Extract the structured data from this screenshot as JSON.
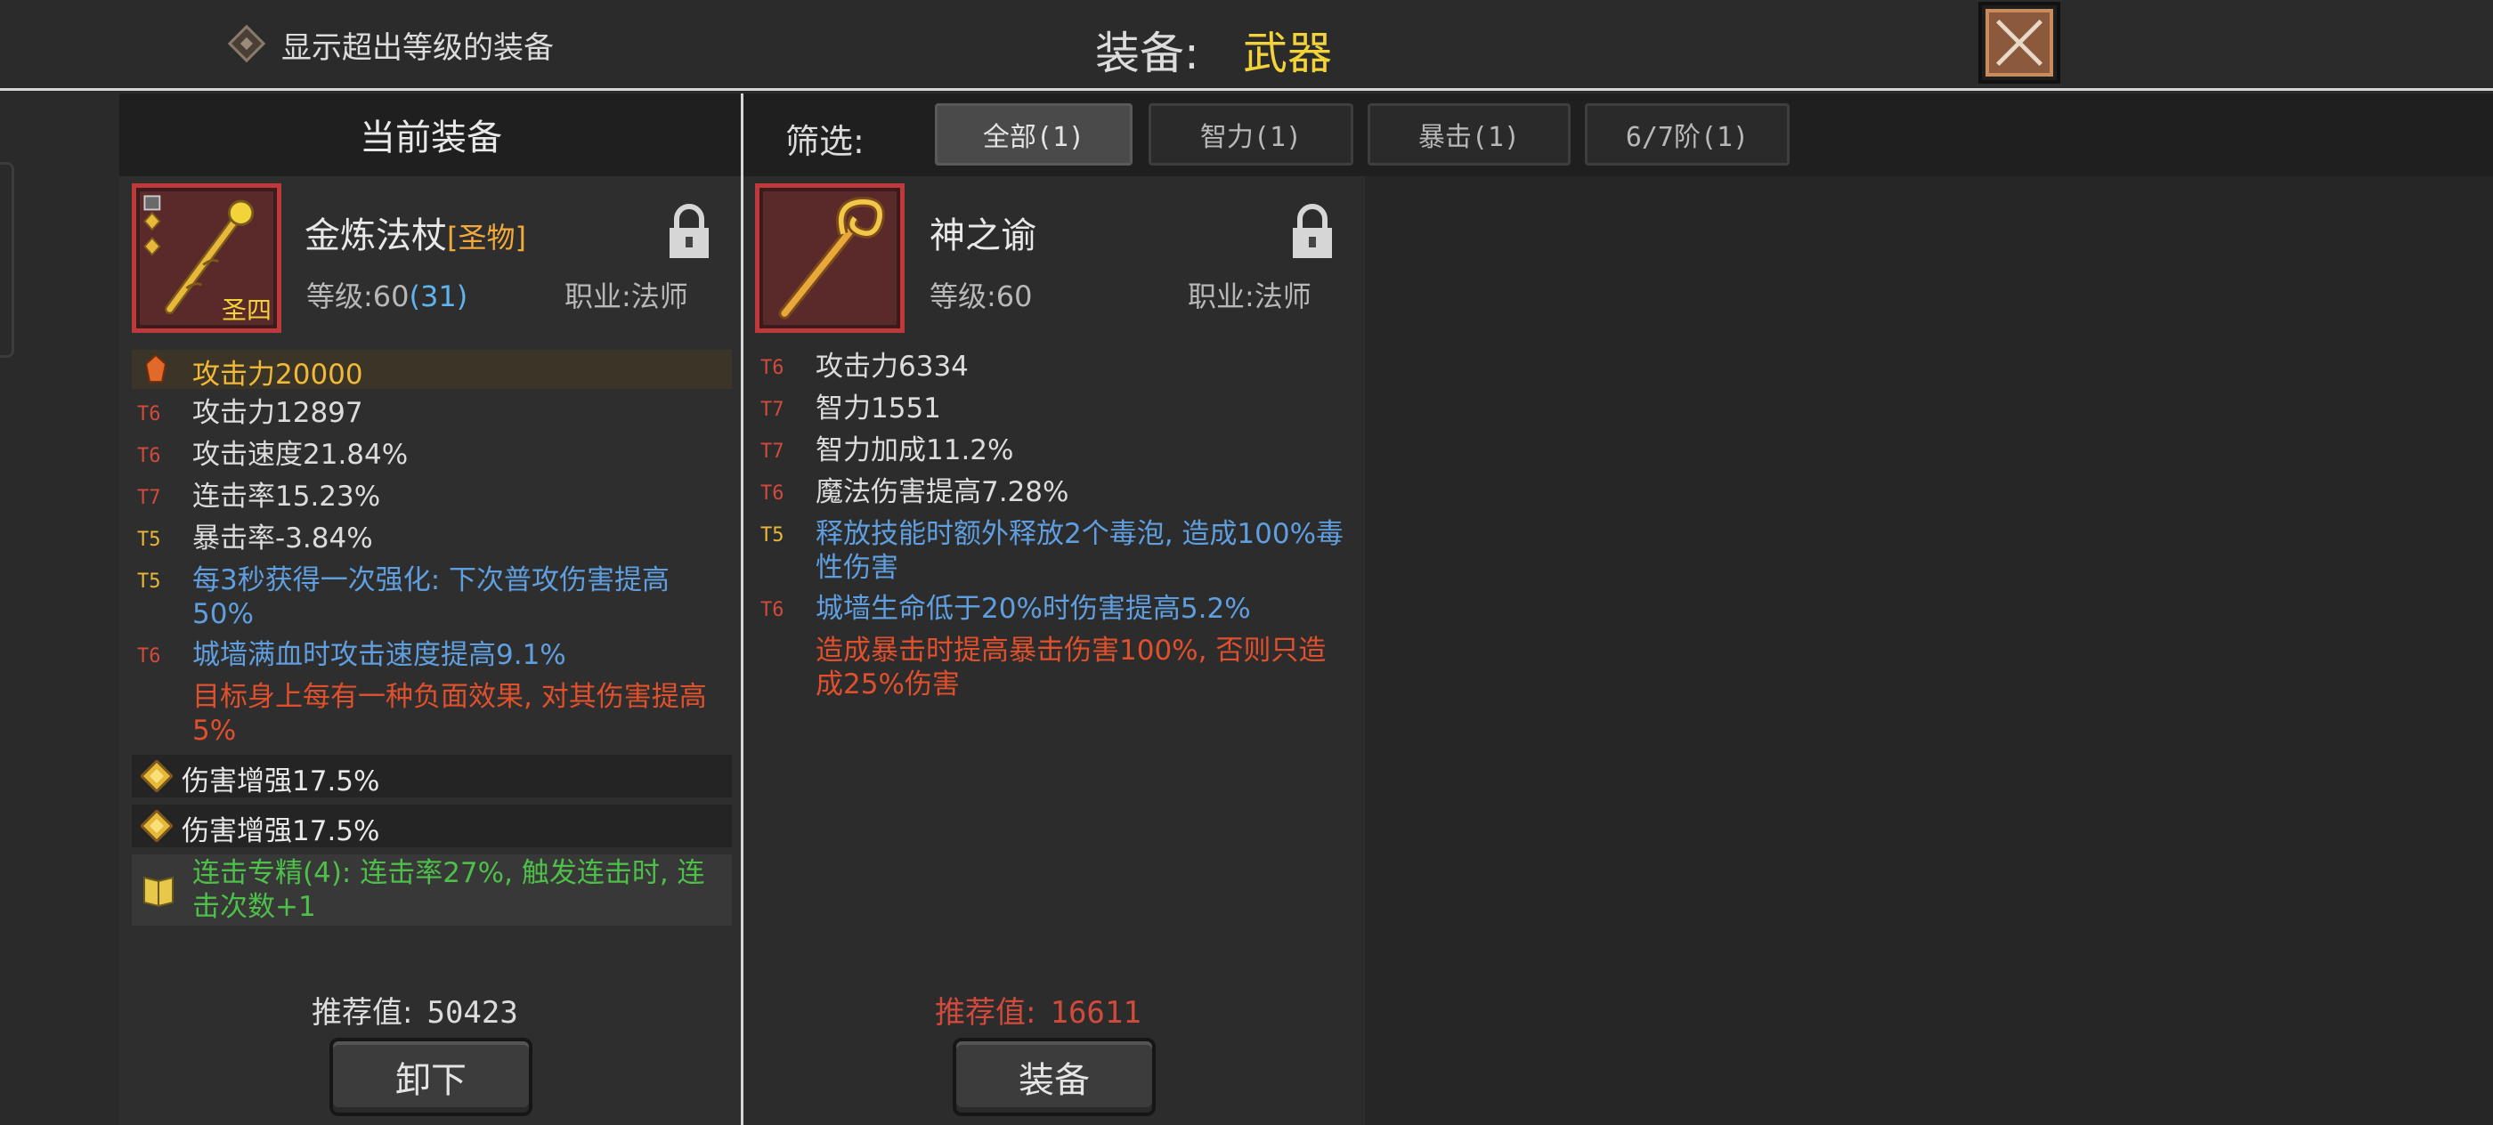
{
  "top": {
    "checkbox_label": "显示超出等级的装备",
    "title_label": "装备:",
    "title_value": "武器"
  },
  "current": {
    "header": "当前装备",
    "name": "金炼法杖",
    "tag": "[圣物]",
    "badge": "圣四",
    "level_label": "等级:60",
    "level_extra": "(31)",
    "class_label": "职业:法师",
    "main_attr": "攻击力20000",
    "stats": [
      {
        "tier": "T6",
        "text": "攻击力12897",
        "color": "#dcdcdc"
      },
      {
        "tier": "T6",
        "text": "攻击速度21.84%",
        "color": "#dcdcdc"
      },
      {
        "tier": "T7",
        "text": "连击率15.23%",
        "color": "#dcdcdc"
      },
      {
        "tier": "T5",
        "text": "暴击率-3.84%",
        "color": "#dcdcdc"
      },
      {
        "tier": "T5",
        "text": "每3秒获得一次强化: 下次普攻伤害提高50%",
        "color": "#5f9fe0"
      },
      {
        "tier": "T6",
        "text": "城墙满血时攻击速度提高9.1%",
        "color": "#5f9fe0"
      },
      {
        "tier": "",
        "text": "目标身上每有一种负面效果, 对其伤害提高5%",
        "color": "#e0502c"
      }
    ],
    "gems": [
      "伤害增强17.5%",
      "伤害增强17.5%"
    ],
    "set_bonus": "连击专精(4): 连击率27%, 触发连击时, 连击次数+1",
    "rec_label": "推荐值:",
    "rec_value": "50423",
    "button": "卸下"
  },
  "filter": {
    "label": "筛选:",
    "tabs": [
      "全部(1)",
      "智力(1)",
      "暴击(1)",
      "6/7阶(1)"
    ],
    "active": 0
  },
  "candidate": {
    "name": "神之谕",
    "level_label": "等级:60",
    "class_label": "职业:法师",
    "stats": [
      {
        "tier": "T6",
        "text": "攻击力6334",
        "color": "#dcdcdc"
      },
      {
        "tier": "T7",
        "text": "智力1551",
        "color": "#dcdcdc"
      },
      {
        "tier": "T7",
        "text": "智力加成11.2%",
        "color": "#dcdcdc"
      },
      {
        "tier": "T6",
        "text": "魔法伤害提高7.28%",
        "color": "#dcdcdc"
      },
      {
        "tier": "T5",
        "text": "释放技能时额外释放2个毒泡, 造成100%毒性伤害",
        "color": "#5f9fe0"
      },
      {
        "tier": "T6",
        "text": "城墙生命低于20%时伤害提高5.2%",
        "color": "#5f9fe0"
      },
      {
        "tier": "",
        "text": "造成暴击时提高暴击伤害100%, 否则只造成25%伤害",
        "color": "#e0502c"
      }
    ],
    "rec_label": "推荐值:",
    "rec_value": "16611",
    "button": "装备"
  },
  "colors": {
    "accent_yellow": "#f2d33a",
    "rarity_red": "#c0393a",
    "tier_red": "#d24a3c",
    "tier_gold": "#e8b83a",
    "set_green": "#4ec04a",
    "rec_red": "#d24a3c"
  }
}
